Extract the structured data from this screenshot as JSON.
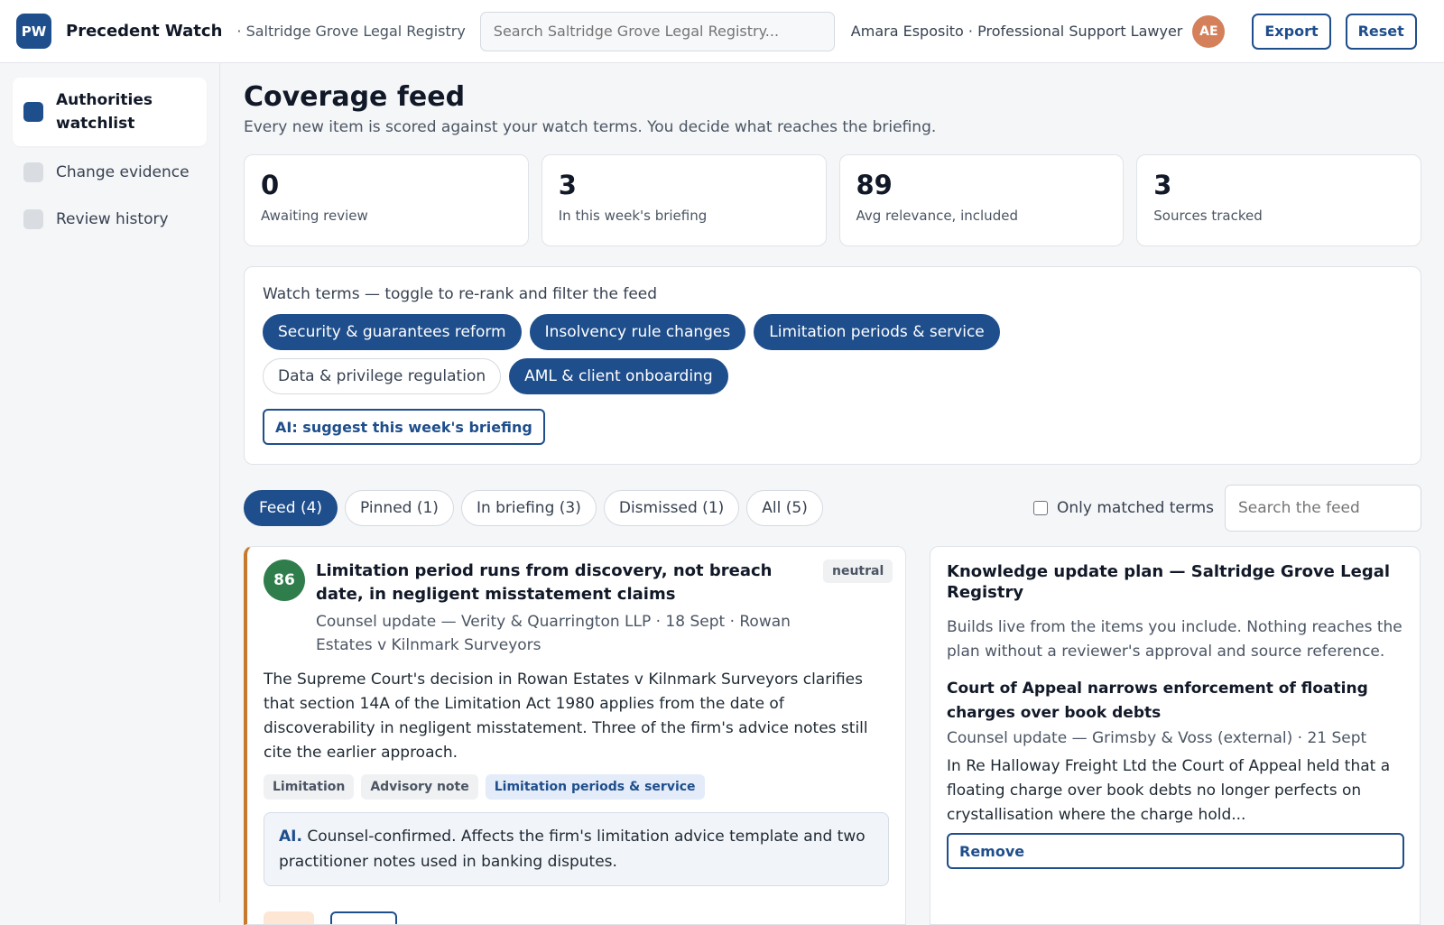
{
  "header": {
    "logo_text": "PW",
    "app_name": "Precedent Watch",
    "workspace": "· Saltridge Grove Legal Registry",
    "search_placeholder": "Search Saltridge Grove Legal Registry...",
    "user": "Amara Esposito · Professional Support Lawyer",
    "avatar_initials": "AE",
    "export_label": "Export",
    "reset_label": "Reset"
  },
  "sidebar": {
    "items": [
      {
        "label": "Authorities watchlist",
        "active": true
      },
      {
        "label": "Change evidence",
        "active": false
      },
      {
        "label": "Review history",
        "active": false
      }
    ]
  },
  "main": {
    "title": "Coverage feed",
    "description": "Every new item is scored against your watch terms. You decide what reaches the briefing.",
    "stats": [
      {
        "value": "0",
        "label": "Awaiting review"
      },
      {
        "value": "3",
        "label": "In this week's briefing"
      },
      {
        "value": "89",
        "label": "Avg relevance, included"
      },
      {
        "value": "3",
        "label": "Sources tracked"
      }
    ],
    "watch_terms": {
      "title": "Watch terms — toggle to re-rank and filter the feed",
      "terms": [
        {
          "label": "Security & guarantees reform",
          "on": true
        },
        {
          "label": "Insolvency rule changes",
          "on": true
        },
        {
          "label": "Limitation periods & service",
          "on": true
        },
        {
          "label": "Data & privilege regulation",
          "on": false
        },
        {
          "label": "AML & client onboarding",
          "on": true
        }
      ],
      "ai_button": "AI: suggest this week's briefing"
    },
    "tabs": [
      {
        "label": "Feed (4)",
        "on": true
      },
      {
        "label": "Pinned (1)",
        "on": false
      },
      {
        "label": "In briefing (3)",
        "on": false
      },
      {
        "label": "Dismissed (1)",
        "on": false
      },
      {
        "label": "All (5)",
        "on": false
      }
    ],
    "only_matched_label": "Only matched terms",
    "feed_search_placeholder": "Search the feed"
  },
  "feed_card": {
    "score": "86",
    "title": "Limitation period runs from discovery, not breach date, in negligent misstatement claims",
    "sentiment": "neutral",
    "meta": "Counsel update — Verity & Quarrington LLP · 18 Sept · Rowan Estates v Kilnmark Surveyors",
    "body": "The Supreme Court's decision in Rowan Estates v Kilnmark Surveyors clarifies that section 14A of the Limitation Act 1980 applies from the date of discoverability in negligent misstatement. Three of the firm's advice notes still cite the earlier approach.",
    "tags": [
      {
        "label": "Limitation",
        "highlight": false
      },
      {
        "label": "Advisory note",
        "highlight": false
      },
      {
        "label": "Limitation periods & service",
        "highlight": true
      }
    ],
    "ai_label": "AI.",
    "ai_text": "Counsel-confirmed. Affects the firm's limitation advice template and two practitioner notes used in banking disputes."
  },
  "plan": {
    "title": "Knowledge update plan — Saltridge Grove Legal Registry",
    "description": "Builds live from the items you include. Nothing reaches the plan without a reviewer's approval and source reference.",
    "item": {
      "title": "Court of Appeal narrows enforcement of floating charges over book debts",
      "meta": "Counsel update — Grimsby & Voss (external) · 21 Sept",
      "body": "In Re Halloway Freight Ltd the Court of Appeal held that a floating charge over book debts no longer perfects on crystallisation where the charge hold...",
      "remove_label": "Remove"
    }
  }
}
